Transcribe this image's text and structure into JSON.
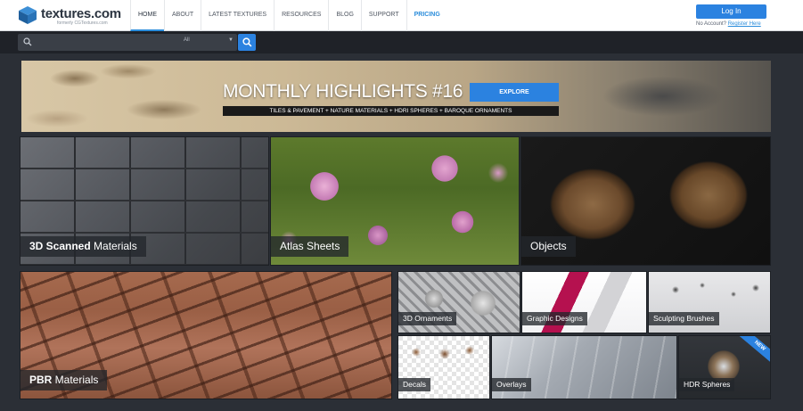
{
  "logo": {
    "text": "textures.com",
    "subtext": "formerly CGTextures.com"
  },
  "nav": {
    "items": [
      "HOME",
      "ABOUT",
      "LATEST TEXTURES",
      "RESOURCES",
      "BLOG",
      "SUPPORT",
      "PRICING"
    ],
    "active": "HOME"
  },
  "auth": {
    "login_label": "Log In",
    "no_account": "No Account?",
    "register_label": "Register Here"
  },
  "search": {
    "placeholder": "",
    "category": "All"
  },
  "banner": {
    "title": "MONTHLY HIGHLIGHTS #16",
    "explore_label": "EXPLORE",
    "tagline": "TILES & PAVEMENT + NATURE MATERIALS + HDRI SPHERES + BAROQUE ORNAMENTS"
  },
  "tiles": {
    "scanned": {
      "label_strong": "3D Scanned",
      "label_rest": " Materials"
    },
    "atlas": {
      "label": "Atlas Sheets"
    },
    "objects": {
      "label": "Objects"
    },
    "pbr": {
      "label_strong": "PBR",
      "label_rest": " Materials"
    },
    "ornaments": {
      "label": "3D Ornaments"
    },
    "graphic": {
      "label": "Graphic Designs"
    },
    "sculpt": {
      "label": "Sculpting Brushes"
    },
    "decals": {
      "label": "Decals"
    },
    "overlays": {
      "label": "Overlays"
    },
    "hdr": {
      "label": "HDR Spheres",
      "badge": "NEW"
    }
  },
  "colors": {
    "accent": "#2b82e0",
    "dark_bg": "#2b2f36",
    "graphic_magenta": "#b5114f"
  }
}
